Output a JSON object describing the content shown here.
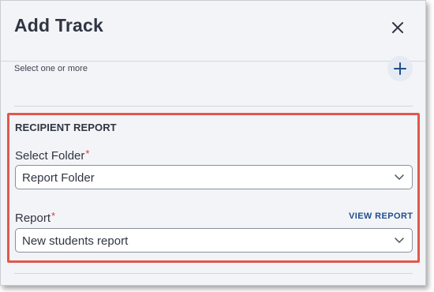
{
  "dialog": {
    "title": "Add Track",
    "helper_text": "Select one or more"
  },
  "recipient_report": {
    "section_title": "RECIPIENT REPORT",
    "folder_label": "Select Folder",
    "folder_required": "*",
    "folder_value": "Report Folder",
    "report_label": "Report",
    "report_required": "*",
    "report_value": "New students report",
    "view_report_link": "VIEW REPORT"
  },
  "icons": {
    "close": "close-icon",
    "add": "plus-icon",
    "dropdown": "chevron-down-icon"
  },
  "colors": {
    "accent": "#1f4e8c",
    "required": "#d9383a",
    "highlight": "#e2574c"
  }
}
